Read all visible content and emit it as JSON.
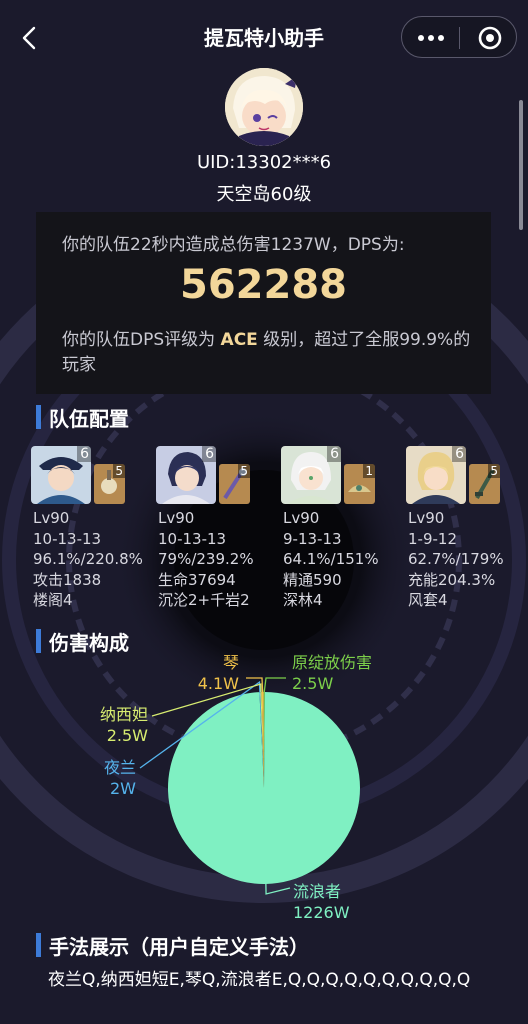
{
  "header": {
    "title": "提瓦特小助手",
    "back_icon": "chevron-left-icon",
    "more_icon": "more-dots-icon",
    "close_icon": "target-circle-icon"
  },
  "profile": {
    "uid": "UID:13302***6",
    "level": "天空岛60级"
  },
  "dps": {
    "summary": "你的队伍22秒内造成总伤害1237W，DPS为:",
    "value": "562288",
    "rating_prefix": "你的队伍DPS评级为 ",
    "rating_grade": "ACE",
    "rating_suffix": " 级别，超过了全服99.9%的玩家",
    "accent_color": "#f3d79a"
  },
  "team": {
    "title": "队伍配置",
    "members": [
      {
        "constellation": "6",
        "refinement": "5",
        "level": "Lv90",
        "talents": "10-13-13",
        "crit": "96.1%/220.8%",
        "main_stat": "攻击1838",
        "artifacts": "楼阁4"
      },
      {
        "constellation": "6",
        "refinement": "5",
        "level": "Lv90",
        "talents": "10-13-13",
        "crit": "79%/239.2%",
        "main_stat": "生命37694",
        "artifacts": "沉沦2+千岩2"
      },
      {
        "constellation": "6",
        "refinement": "1",
        "level": "Lv90",
        "talents": "9-13-13",
        "crit": "64.1%/151%",
        "main_stat": "精通590",
        "artifacts": "深林4"
      },
      {
        "constellation": "6",
        "refinement": "5",
        "level": "Lv90",
        "talents": "1-9-12",
        "crit": "62.7%/179%",
        "main_stat": "充能204.3%",
        "artifacts": "风套4"
      }
    ]
  },
  "damage": {
    "title": "伤害构成",
    "chart_data": {
      "type": "pie",
      "series": [
        {
          "name": "流浪者",
          "value": 1226,
          "label": "1226W",
          "color": "#7ff0c2"
        },
        {
          "name": "夜兰",
          "value": 2,
          "label": "2W",
          "color": "#55b3ec"
        },
        {
          "name": "纳西妲",
          "value": 2.5,
          "label": "2.5W",
          "color": "#d7ec70"
        },
        {
          "name": "琴",
          "value": 4.1,
          "label": "4.1W",
          "color": "#f0c24a"
        },
        {
          "name": "原绽放伤害",
          "value": 2.5,
          "label": "2.5W",
          "color": "#7ccf4a"
        }
      ]
    }
  },
  "technique": {
    "title": "手法展示（用户自定义手法）",
    "combo": "夜兰Q,纳西妲短E,琴Q,流浪者E,Q,Q,Q,Q,Q,Q,Q,Q,Q,Q"
  }
}
